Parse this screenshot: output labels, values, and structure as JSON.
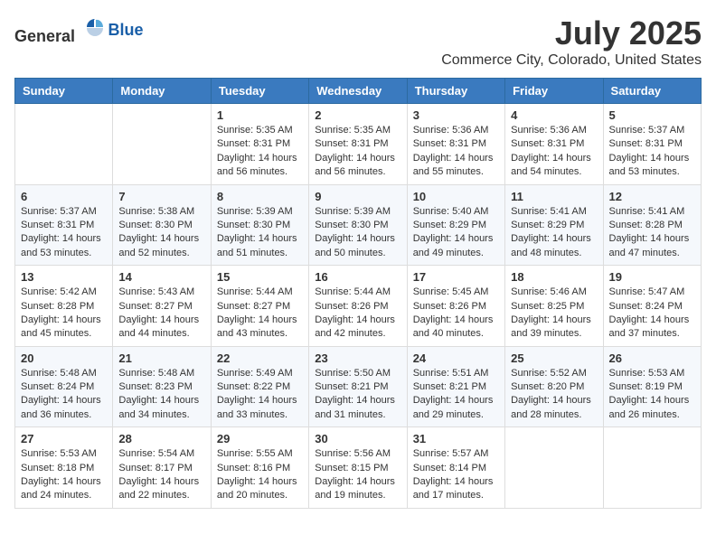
{
  "logo": {
    "general": "General",
    "blue": "Blue"
  },
  "title": "July 2025",
  "location": "Commerce City, Colorado, United States",
  "days_of_week": [
    "Sunday",
    "Monday",
    "Tuesday",
    "Wednesday",
    "Thursday",
    "Friday",
    "Saturday"
  ],
  "weeks": [
    [
      {
        "day": "",
        "info": ""
      },
      {
        "day": "",
        "info": ""
      },
      {
        "day": "1",
        "info": "Sunrise: 5:35 AM\nSunset: 8:31 PM\nDaylight: 14 hours and 56 minutes."
      },
      {
        "day": "2",
        "info": "Sunrise: 5:35 AM\nSunset: 8:31 PM\nDaylight: 14 hours and 56 minutes."
      },
      {
        "day": "3",
        "info": "Sunrise: 5:36 AM\nSunset: 8:31 PM\nDaylight: 14 hours and 55 minutes."
      },
      {
        "day": "4",
        "info": "Sunrise: 5:36 AM\nSunset: 8:31 PM\nDaylight: 14 hours and 54 minutes."
      },
      {
        "day": "5",
        "info": "Sunrise: 5:37 AM\nSunset: 8:31 PM\nDaylight: 14 hours and 53 minutes."
      }
    ],
    [
      {
        "day": "6",
        "info": "Sunrise: 5:37 AM\nSunset: 8:31 PM\nDaylight: 14 hours and 53 minutes."
      },
      {
        "day": "7",
        "info": "Sunrise: 5:38 AM\nSunset: 8:30 PM\nDaylight: 14 hours and 52 minutes."
      },
      {
        "day": "8",
        "info": "Sunrise: 5:39 AM\nSunset: 8:30 PM\nDaylight: 14 hours and 51 minutes."
      },
      {
        "day": "9",
        "info": "Sunrise: 5:39 AM\nSunset: 8:30 PM\nDaylight: 14 hours and 50 minutes."
      },
      {
        "day": "10",
        "info": "Sunrise: 5:40 AM\nSunset: 8:29 PM\nDaylight: 14 hours and 49 minutes."
      },
      {
        "day": "11",
        "info": "Sunrise: 5:41 AM\nSunset: 8:29 PM\nDaylight: 14 hours and 48 minutes."
      },
      {
        "day": "12",
        "info": "Sunrise: 5:41 AM\nSunset: 8:28 PM\nDaylight: 14 hours and 47 minutes."
      }
    ],
    [
      {
        "day": "13",
        "info": "Sunrise: 5:42 AM\nSunset: 8:28 PM\nDaylight: 14 hours and 45 minutes."
      },
      {
        "day": "14",
        "info": "Sunrise: 5:43 AM\nSunset: 8:27 PM\nDaylight: 14 hours and 44 minutes."
      },
      {
        "day": "15",
        "info": "Sunrise: 5:44 AM\nSunset: 8:27 PM\nDaylight: 14 hours and 43 minutes."
      },
      {
        "day": "16",
        "info": "Sunrise: 5:44 AM\nSunset: 8:26 PM\nDaylight: 14 hours and 42 minutes."
      },
      {
        "day": "17",
        "info": "Sunrise: 5:45 AM\nSunset: 8:26 PM\nDaylight: 14 hours and 40 minutes."
      },
      {
        "day": "18",
        "info": "Sunrise: 5:46 AM\nSunset: 8:25 PM\nDaylight: 14 hours and 39 minutes."
      },
      {
        "day": "19",
        "info": "Sunrise: 5:47 AM\nSunset: 8:24 PM\nDaylight: 14 hours and 37 minutes."
      }
    ],
    [
      {
        "day": "20",
        "info": "Sunrise: 5:48 AM\nSunset: 8:24 PM\nDaylight: 14 hours and 36 minutes."
      },
      {
        "day": "21",
        "info": "Sunrise: 5:48 AM\nSunset: 8:23 PM\nDaylight: 14 hours and 34 minutes."
      },
      {
        "day": "22",
        "info": "Sunrise: 5:49 AM\nSunset: 8:22 PM\nDaylight: 14 hours and 33 minutes."
      },
      {
        "day": "23",
        "info": "Sunrise: 5:50 AM\nSunset: 8:21 PM\nDaylight: 14 hours and 31 minutes."
      },
      {
        "day": "24",
        "info": "Sunrise: 5:51 AM\nSunset: 8:21 PM\nDaylight: 14 hours and 29 minutes."
      },
      {
        "day": "25",
        "info": "Sunrise: 5:52 AM\nSunset: 8:20 PM\nDaylight: 14 hours and 28 minutes."
      },
      {
        "day": "26",
        "info": "Sunrise: 5:53 AM\nSunset: 8:19 PM\nDaylight: 14 hours and 26 minutes."
      }
    ],
    [
      {
        "day": "27",
        "info": "Sunrise: 5:53 AM\nSunset: 8:18 PM\nDaylight: 14 hours and 24 minutes."
      },
      {
        "day": "28",
        "info": "Sunrise: 5:54 AM\nSunset: 8:17 PM\nDaylight: 14 hours and 22 minutes."
      },
      {
        "day": "29",
        "info": "Sunrise: 5:55 AM\nSunset: 8:16 PM\nDaylight: 14 hours and 20 minutes."
      },
      {
        "day": "30",
        "info": "Sunrise: 5:56 AM\nSunset: 8:15 PM\nDaylight: 14 hours and 19 minutes."
      },
      {
        "day": "31",
        "info": "Sunrise: 5:57 AM\nSunset: 8:14 PM\nDaylight: 14 hours and 17 minutes."
      },
      {
        "day": "",
        "info": ""
      },
      {
        "day": "",
        "info": ""
      }
    ]
  ]
}
